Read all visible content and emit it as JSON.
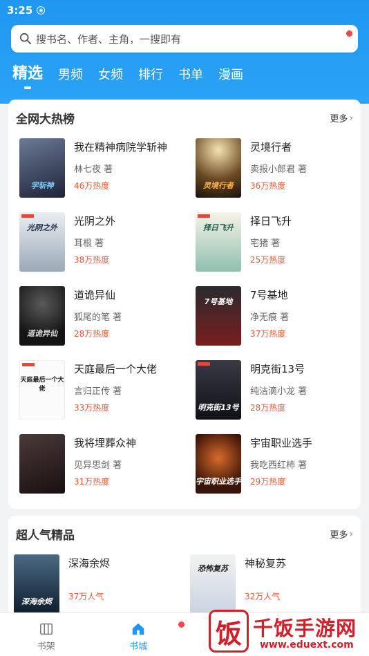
{
  "status": {
    "time": "3:25"
  },
  "search": {
    "placeholder": "搜书名、作者、主角，一搜即有"
  },
  "tabs": [
    "精选",
    "男频",
    "女频",
    "排行",
    "书单",
    "漫画"
  ],
  "hot": {
    "title": "全网大热榜",
    "more": "更多",
    "books": [
      {
        "title": "我在精神病院学斩神",
        "author": "林七夜 著",
        "heat": "46万热度",
        "cover_text": "学斩神"
      },
      {
        "title": "灵境行者",
        "author": "卖报小郎君 著",
        "heat": "36万热度",
        "cover_text": "灵境行者"
      },
      {
        "title": "光阴之外",
        "author": "耳根  著",
        "heat": "38万热度",
        "cover_text": "光阴之外"
      },
      {
        "title": "择日飞升",
        "author": "宅猪 著",
        "heat": "25万热度",
        "cover_text": "择日飞升"
      },
      {
        "title": "道诡异仙",
        "author": "狐尾的笔 著",
        "heat": "28万热度",
        "cover_text": "道诡异仙"
      },
      {
        "title": "7号基地",
        "author": "净无痕 著",
        "heat": "37万热度",
        "cover_text": "7号基地"
      },
      {
        "title": "天庭最后一个大佬",
        "author": "言归正传 著",
        "heat": "33万热度",
        "cover_text": "天庭最后一个大佬"
      },
      {
        "title": "明克街13号",
        "author": "纯洁滴小龙 著",
        "heat": "28万热度",
        "cover_text": "明克街13号"
      },
      {
        "title": "我将埋葬众神",
        "author": "见异思剑 著",
        "heat": "31万热度",
        "cover_text": ""
      },
      {
        "title": "宇宙职业选手",
        "author": "我吃西红柿 著",
        "heat": "29万热度",
        "cover_text": "宇宙职业选手"
      }
    ]
  },
  "popular": {
    "title": "超人气精品",
    "more": "更多",
    "books": [
      {
        "title": "深海余烬",
        "heat": "37万人气",
        "cover_text": "深海余烬"
      },
      {
        "title": "神秘复苏",
        "heat": "32万人气",
        "cover_text": "恐怖复苏"
      }
    ]
  },
  "nav": {
    "shelf": "书架",
    "store": "书城"
  },
  "watermark": {
    "name": "千饭手游网",
    "url": "www.eduext.com",
    "glyph": "饭"
  },
  "colors": {
    "accent": "#1f97f2",
    "heat": "#e65a3a",
    "badge": "#f0454a"
  }
}
